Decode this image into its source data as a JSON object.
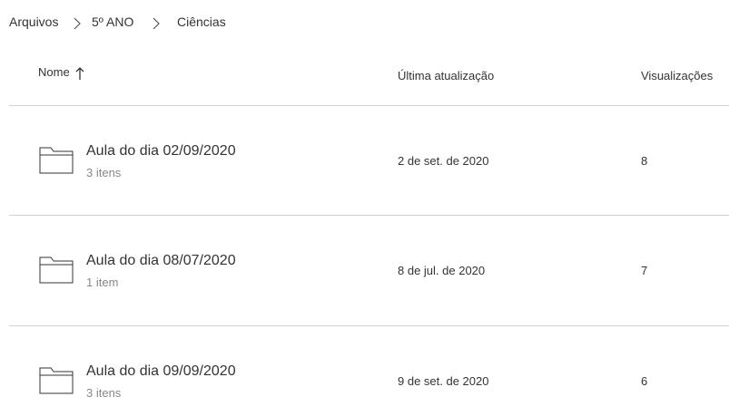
{
  "breadcrumb": {
    "items": [
      "Arquivos",
      "5º ANO",
      "Ciências"
    ]
  },
  "header": {
    "name_label": "Nome",
    "updated_label": "Última atualização",
    "views_label": "Visualizações",
    "sort_icon": "arrow-up-icon"
  },
  "rows": [
    {
      "name": "Aula do dia 02/09/2020",
      "count": "3 itens",
      "updated": "2 de set. de 2020",
      "views": "8",
      "icon": "folder-icon"
    },
    {
      "name": "Aula do dia 08/07/2020",
      "count": "1 item",
      "updated": "8 de jul. de 2020",
      "views": "7",
      "icon": "folder-icon"
    },
    {
      "name": "Aula do dia 09/09/2020",
      "count": "3 itens",
      "updated": "9 de set. de 2020",
      "views": "6",
      "icon": "folder-icon"
    }
  ]
}
